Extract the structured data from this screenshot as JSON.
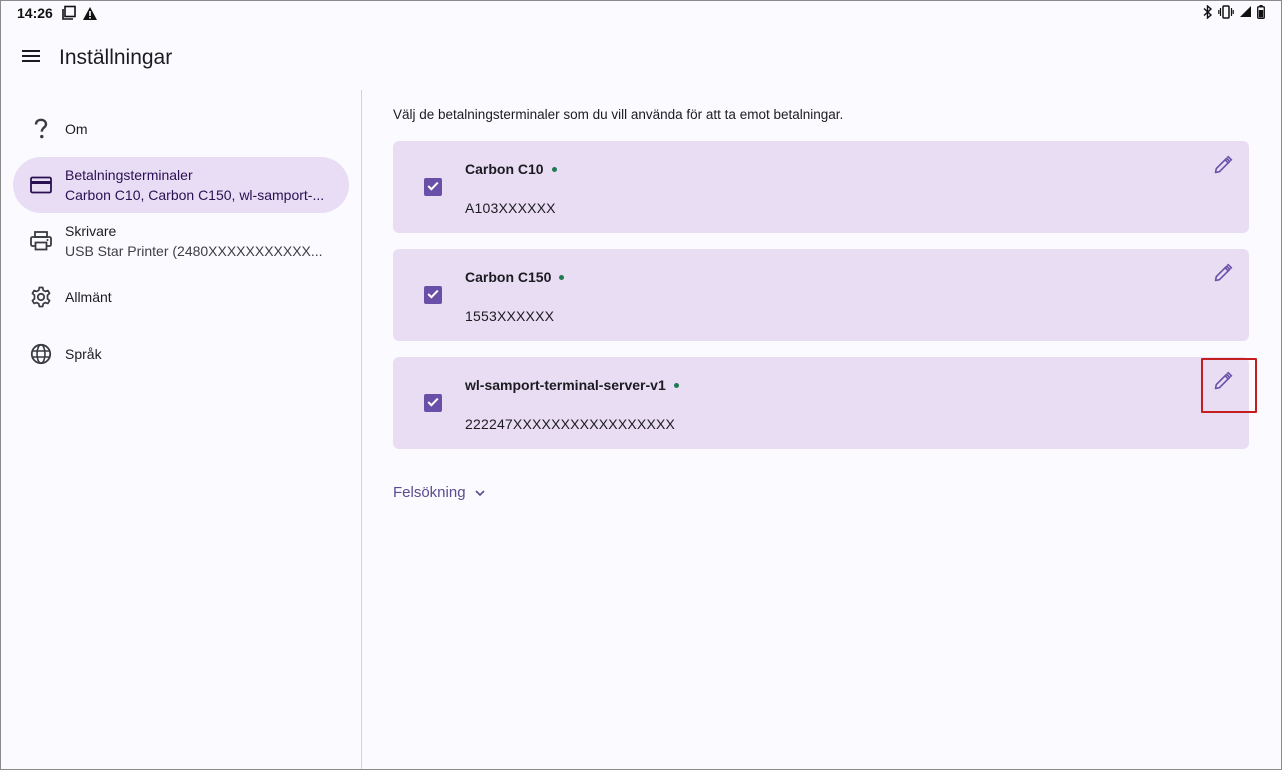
{
  "status_bar": {
    "time": "14:26"
  },
  "app_bar": {
    "title": "Inställningar"
  },
  "sidebar": {
    "items": [
      {
        "label": "Om",
        "icon": "help-icon"
      },
      {
        "label": "Betalningsterminaler",
        "sub": "Carbon C10, Carbon C150, wl-samport-...",
        "icon": "credit-card-icon",
        "active": true
      },
      {
        "label": "Skrivare",
        "sub": "USB Star Printer (2480XXXXXXXXXXX...",
        "icon": "printer-icon"
      },
      {
        "label": "Allmänt",
        "icon": "gear-icon"
      },
      {
        "label": "Språk",
        "icon": "globe-icon"
      }
    ]
  },
  "main": {
    "intro": "Välj de betalningsterminaler som du vill använda för att ta emot betalningar.",
    "terminals": [
      {
        "name": "Carbon C10",
        "serial": "A103XXXXXX",
        "checked": true,
        "online": true
      },
      {
        "name": "Carbon C150",
        "serial": "1553XXXXXX",
        "checked": true,
        "online": true
      },
      {
        "name": "wl-samport-terminal-server-v1",
        "serial": "222247XXXXXXXXXXXXXXXXX",
        "checked": true,
        "online": true
      }
    ],
    "troubleshoot_label": "Felsökning"
  },
  "colors": {
    "accent": "#6a4fa8",
    "card_bg": "#e9ddf4",
    "active_nav_bg": "#e8ddf4",
    "online_dot": "#1f7a52",
    "highlight_border": "#c41e1e",
    "link": "#5d4a92"
  }
}
